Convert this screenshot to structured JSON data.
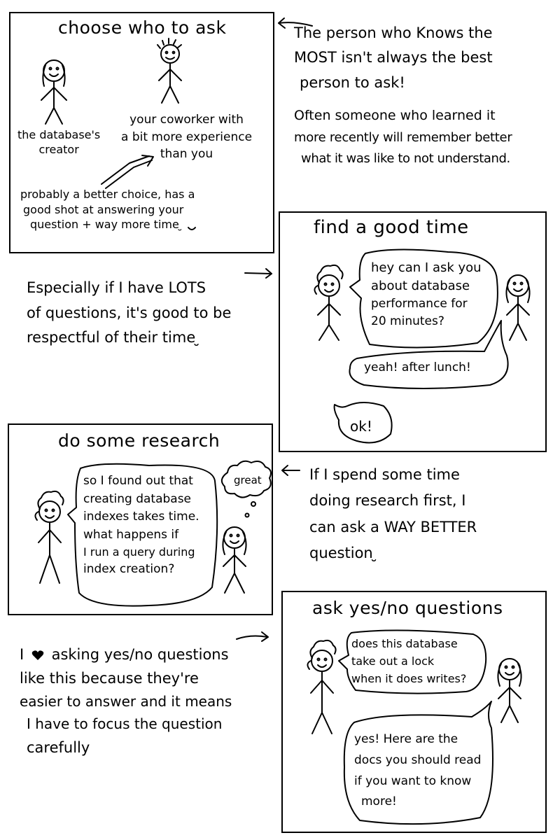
{
  "panel1": {
    "title": "choose who to ask",
    "creator_caption": [
      "the database's",
      "creator"
    ],
    "coworker_caption": [
      "your coworker with",
      "a bit more experience",
      "than you"
    ],
    "better_choice": [
      "probably a better choice, has a",
      "good shot at answering your",
      "question + way more time ̮"
    ]
  },
  "note1": [
    "The person who Knows the",
    "MOST isn't always the best",
    "person to ask!",
    "Often someone who learned it",
    "more recently will remember better",
    "what it was like to not understand."
  ],
  "panel2": {
    "title": "find a good time",
    "ask_bubble": [
      "hey can I ask you",
      "about database",
      "performance for",
      "20 minutes?"
    ],
    "reply_bubble": "yeah! after lunch!",
    "ok_bubble": "ok!"
  },
  "note2": [
    "Especially if I have LOTS",
    "of questions, it's good to be",
    "respectful of their time ̮"
  ],
  "panel3": {
    "title": "do some research",
    "question_bubble": [
      "so I found out that",
      "creating database",
      "indexes takes time.",
      "what happens if",
      "I run a query during",
      "index creation?"
    ],
    "thought_bubble": "great"
  },
  "note3": [
    "If I spend some time",
    "doing research first, I",
    "can ask a WAY BETTER",
    "question ̮"
  ],
  "panel4": {
    "title": "ask yes/no questions",
    "question_bubble": [
      "does this database",
      "take out a lock",
      "when it does writes?"
    ],
    "answer_bubble": [
      "yes! Here are the",
      "docs you should read",
      "if you want to know",
      "more!"
    ]
  },
  "note4": {
    "line1_a": "I",
    "line1_b": "asking yes/no questions",
    "rest": [
      "like this because they're",
      "easier to answer and it means",
      "I have to focus the question",
      "carefully"
    ]
  }
}
